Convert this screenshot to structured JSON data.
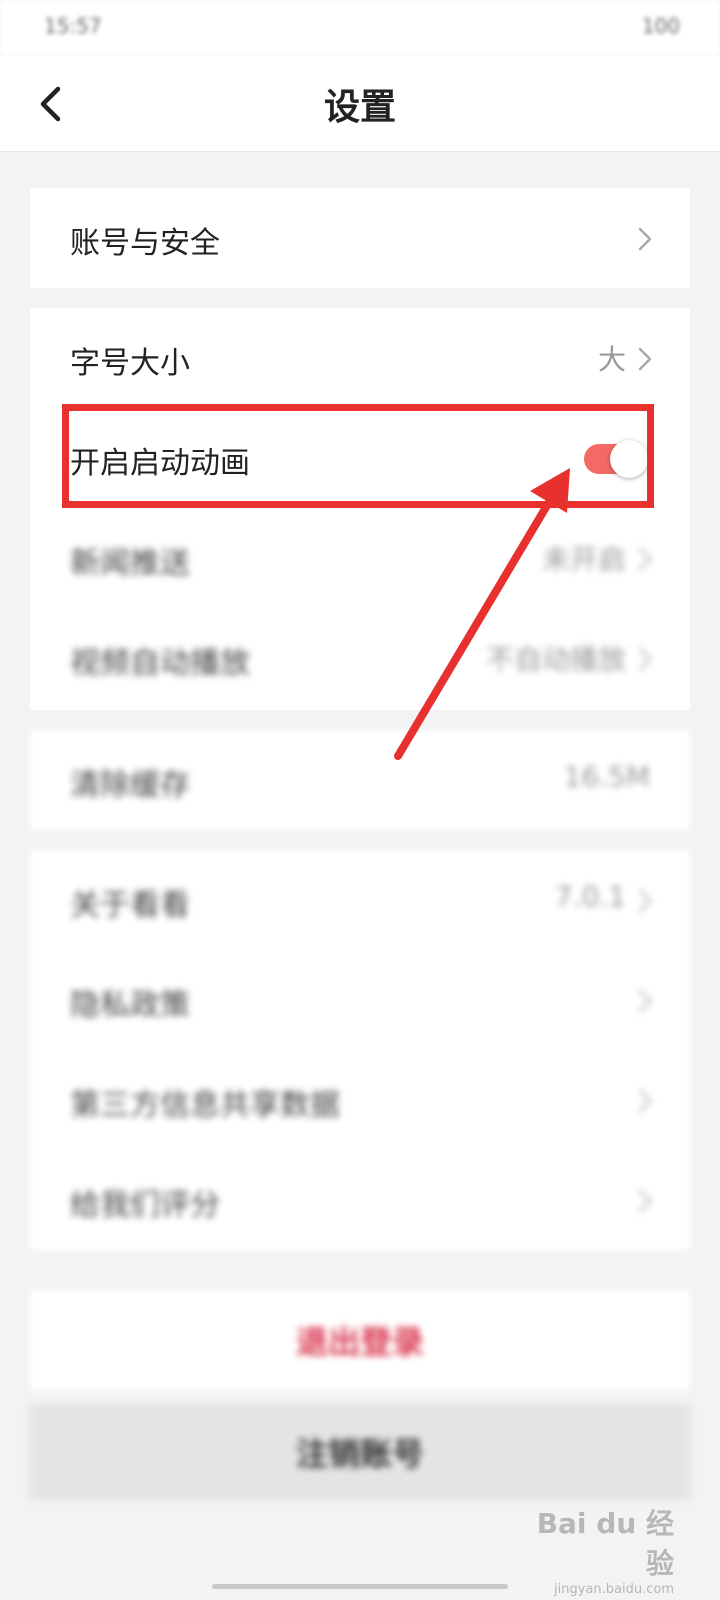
{
  "status_bar": {
    "time": "15:57",
    "battery": "100"
  },
  "header": {
    "title": "设置",
    "back_icon": "chevron-left-icon"
  },
  "account_section": {
    "items": [
      {
        "label": "账号与安全",
        "chevron": true
      }
    ]
  },
  "display_section": {
    "font_size": {
      "label": "字号大小",
      "value": "大"
    },
    "startup_animation": {
      "label": "开启启动动画",
      "enabled": true
    },
    "news_push": {
      "label": "新闻推送",
      "value": "未开启"
    },
    "video_autoplay": {
      "label": "视频自动播放",
      "value": "不自动播放"
    }
  },
  "cache_section": {
    "label": "清除缓存",
    "value": "16.5M"
  },
  "about_section": {
    "about": {
      "label": "关于看看",
      "value": "7.0.1"
    },
    "privacy": {
      "label": "隐私政策"
    },
    "third_party": {
      "label": "第三方信息共享数据"
    },
    "rate": {
      "label": "给我们评分"
    }
  },
  "actions": {
    "logout": "退出登录",
    "cancel_account": "注销账号"
  },
  "watermark": {
    "brand": "Bai du 经验",
    "url": "jingyan.baidu.com"
  },
  "colors": {
    "toggle_on": "#f26a63",
    "annotation": "#e8312f",
    "logout_text": "#d8324a",
    "background": "#f3f3f3"
  }
}
